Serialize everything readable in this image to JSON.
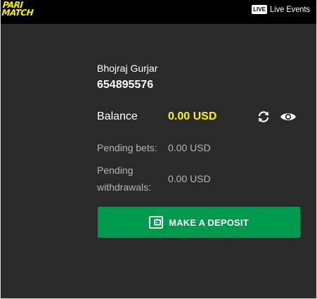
{
  "brand": {
    "line1": "PARI",
    "line2": "MATCH",
    "accent": "#fff200"
  },
  "header": {
    "live_badge": "LIVE",
    "live_label": "Live Events"
  },
  "user": {
    "name": "Bhojraj Gurjar",
    "id": "654895576"
  },
  "balance": {
    "label": "Balance",
    "value": "0.00 USD",
    "refresh_icon": "refresh-icon",
    "visibility_icon": "eye-icon"
  },
  "pending": {
    "bets_label": "Pending bets:",
    "bets_value": "0.00 USD",
    "withdrawals_label_line1": "Pending",
    "withdrawals_label_line2": "withdrawals:",
    "withdrawals_value": "0.00 USD"
  },
  "deposit": {
    "label": "MAKE A DEPOSIT",
    "icon": "wallet-icon",
    "color": "#009a4e"
  }
}
